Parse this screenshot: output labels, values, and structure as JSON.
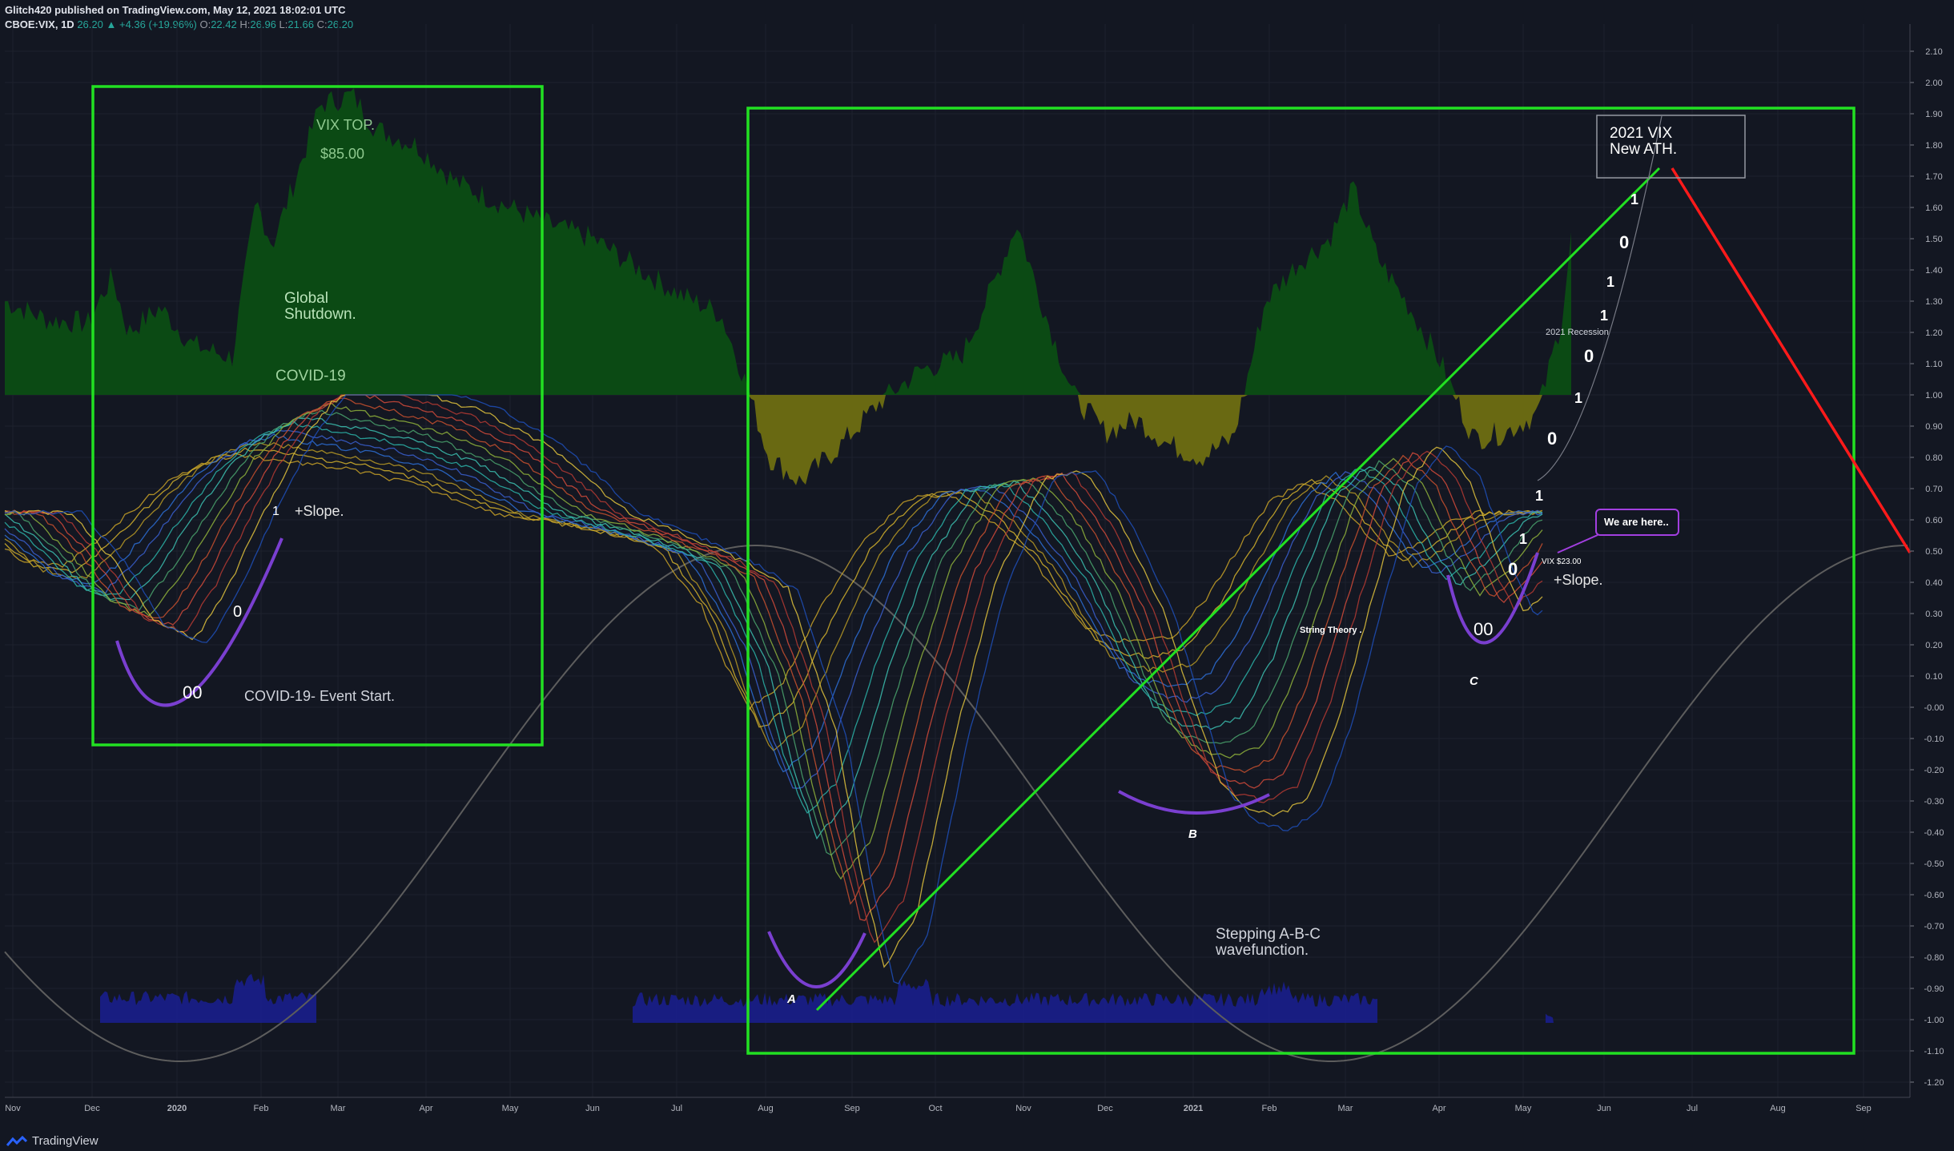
{
  "header": {
    "line1": "Glitch420 published on TradingView.com, May 12, 2021 18:02:01 UTC",
    "symbol": "CBOE:VIX, 1D",
    "last": "26.20",
    "change": "+4.36 (+19.96%)",
    "o_label": "O:",
    "o": "22.42",
    "h_label": "H:",
    "h": "26.96",
    "l_label": "L:",
    "l": "21.66",
    "c_label": "C:",
    "c": "26.20"
  },
  "footer": {
    "brand": "TradingView"
  },
  "colors": {
    "background": "#131722",
    "green_area": "#0b4d14",
    "yellow_area": "#6e6e12",
    "box": "#22e022",
    "trendline": "#22e022",
    "red_line": "#ff1a1a",
    "arc": "#7a3fd0",
    "sine": "#5d5d5d",
    "volume": "#1a1e8c"
  },
  "chart_data": {
    "type": "line",
    "symbol": "CBOE:VIX",
    "interval": "1D",
    "y_ticks": [
      "2.10",
      "2.00",
      "1.90",
      "1.80",
      "1.70",
      "1.60",
      "1.50",
      "1.40",
      "1.30",
      "1.20",
      "1.10",
      "1.00",
      "0.90",
      "0.80",
      "0.70",
      "0.60",
      "0.50",
      "0.40",
      "0.30",
      "0.20",
      "0.10",
      "-0.00",
      "-0.10",
      "-0.20",
      "-0.30",
      "-0.40",
      "-0.50",
      "-0.60",
      "-0.70",
      "-0.80",
      "-0.90",
      "-1.00",
      "-1.10",
      "-1.20"
    ],
    "ylim": [
      -1.25,
      2.15
    ],
    "x_ticks": [
      "Nov",
      "Dec",
      "2020",
      "Feb",
      "Mar",
      "Apr",
      "May",
      "Jun",
      "Jul",
      "Aug",
      "Sep",
      "Oct",
      "Nov",
      "Dec",
      "2021",
      "Feb",
      "Mar",
      "Apr",
      "May",
      "Jun",
      "Jul",
      "Aug",
      "Sep"
    ],
    "grid": true,
    "annotations": {
      "vix_top": "VIX TOP.",
      "price_85": "$85.00",
      "global_shutdown": "Global\nShutdown.",
      "covid19": "COVID-19",
      "slope_1": "+Slope.",
      "slope_2": "+Slope.",
      "covid_event": "COVID-19- Event Start.",
      "vix_ath": "2021 VIX\nNew ATH.",
      "recession": "2021 Recession",
      "we_are_here": "We are here..",
      "vix_price": "VIX $23.00",
      "string_theory": "String Theory .",
      "stepping": "Stepping A-B-C\nwavefunction.",
      "wave_a": "A",
      "wave_b": "B",
      "wave_c": "C",
      "zero_zero": "00",
      "binary_left": [
        "1",
        "0"
      ],
      "binary_right": [
        "1",
        "0",
        "1",
        "1",
        "0",
        "1",
        "0",
        "1",
        "1",
        "0"
      ]
    }
  }
}
